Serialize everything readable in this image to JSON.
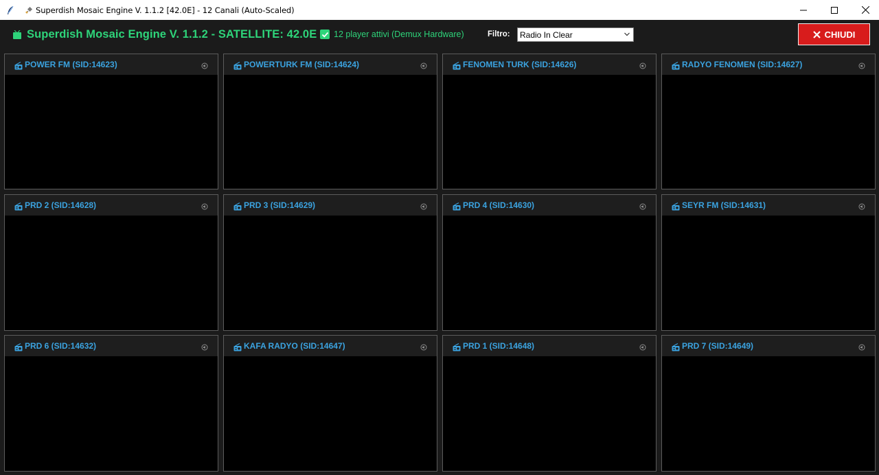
{
  "window": {
    "title": "Superdish Mosaic Engine V. 1.1.2 [42.0E] - 12 Canali (Auto-Scaled)"
  },
  "header": {
    "app_title": "Superdish Mosaic Engine V. 1.1.2 - SATELLITE: 42.0E",
    "active_players_label": "12 player attivi (Demux Hardware)",
    "active_players_checked": true,
    "filter_label": "Filtro:",
    "filter_value": "Radio In Clear",
    "close_label": "CHIUDI"
  },
  "colors": {
    "accent_green": "#2ed47a",
    "channel_blue": "#3ba3e0",
    "close_red": "#d81c1c"
  },
  "channels": [
    {
      "title": "POWER FM (SID:14623)"
    },
    {
      "title": "POWERTURK FM (SID:14624)"
    },
    {
      "title": "FENOMEN TURK (SID:14626)"
    },
    {
      "title": "RADYO FENOMEN (SID:14627)"
    },
    {
      "title": "PRD 2 (SID:14628)"
    },
    {
      "title": "PRD 3 (SID:14629)"
    },
    {
      "title": "PRD 4 (SID:14630)"
    },
    {
      "title": "SEYR FM (SID:14631)"
    },
    {
      "title": "PRD 6 (SID:14632)"
    },
    {
      "title": "KAFA RADYO (SID:14647)"
    },
    {
      "title": "PRD 1 (SID:14648)"
    },
    {
      "title": "PRD 7 (SID:14649)"
    }
  ]
}
